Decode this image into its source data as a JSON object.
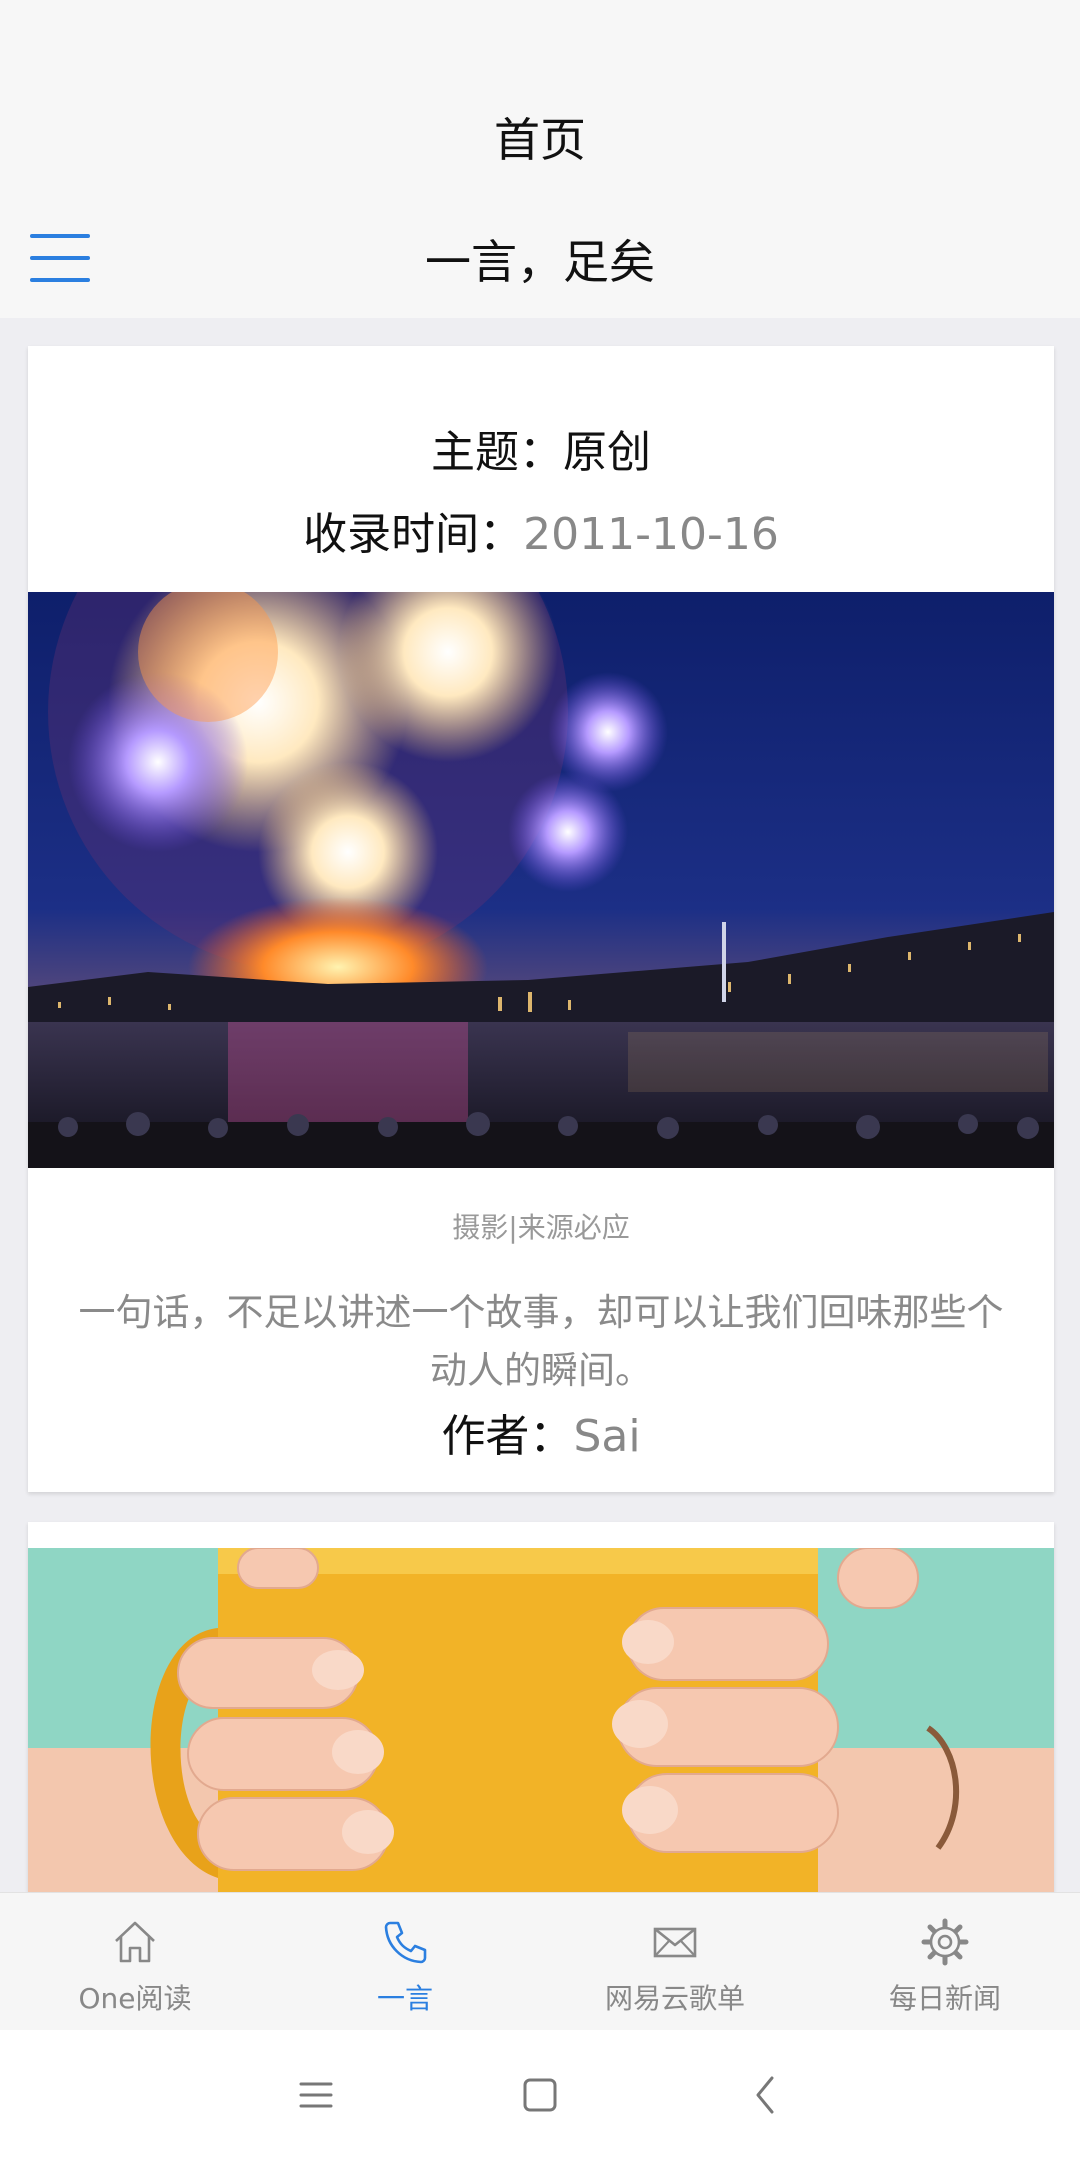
{
  "header": {
    "page_title": "首页",
    "subtitle": "一言，足矣",
    "menu_icon": "hamburger-menu-icon"
  },
  "card1": {
    "topic_label": "主题：",
    "topic_value": "原创",
    "time_label": "收录时间：",
    "time_value": "2011-10-16",
    "photo_credit": "摄影|来源必应",
    "quote": "一句话，不足以讲述一个故事，却可以让我们回味那些个动人的瞬间。",
    "author_label": "作者：",
    "author_value": "Sai"
  },
  "tabbar": {
    "tabs": [
      {
        "label": "One阅读",
        "icon": "home-icon",
        "active": false
      },
      {
        "label": "一言",
        "icon": "phone-icon",
        "active": true
      },
      {
        "label": "网易云歌单",
        "icon": "mail-icon",
        "active": false
      },
      {
        "label": "每日新闻",
        "icon": "gear-icon",
        "active": false
      }
    ]
  },
  "colors": {
    "accent": "#2b7fe0",
    "tab_inactive": "#888888",
    "background": "#eeeef2"
  }
}
